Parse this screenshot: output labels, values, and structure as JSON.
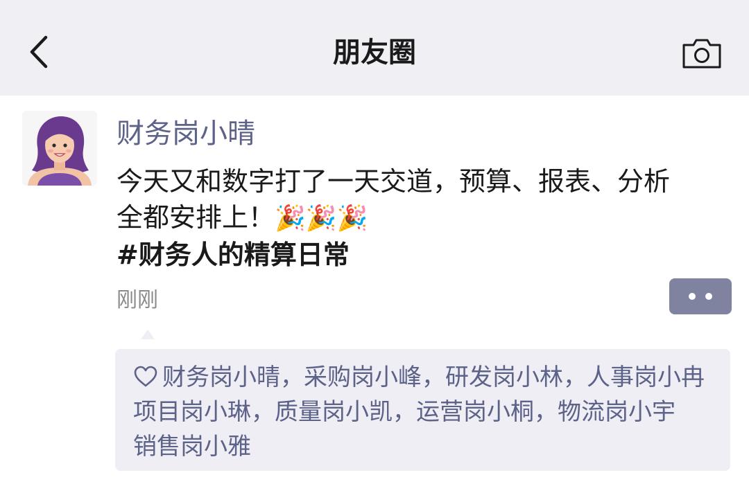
{
  "header": {
    "title": "朋友圈",
    "back_icon": "chevron-left-icon",
    "camera_icon": "camera-icon"
  },
  "post": {
    "author": "财务岗小晴",
    "text_line1": "今天又和数字打了一天交道，预算、报表、分析",
    "text_line2": "全都安排上！",
    "emoji": "🎉",
    "hashtag": "#财务人的精算日常",
    "time": "刚刚"
  },
  "likes": {
    "icon": "heart-icon",
    "line1": "财务岗小晴，采购岗小峰，研发岗小林，人事岗小冉",
    "line2": "项目岗小琳，质量岗小凯，运营岗小桐，物流岗小宇",
    "line3": "销售岗小雅"
  },
  "colors": {
    "header_bg": "#efeff4",
    "name_blue": "#5c6288",
    "more_button": "#7f83a0",
    "likes_bg": "#eeeef4"
  }
}
